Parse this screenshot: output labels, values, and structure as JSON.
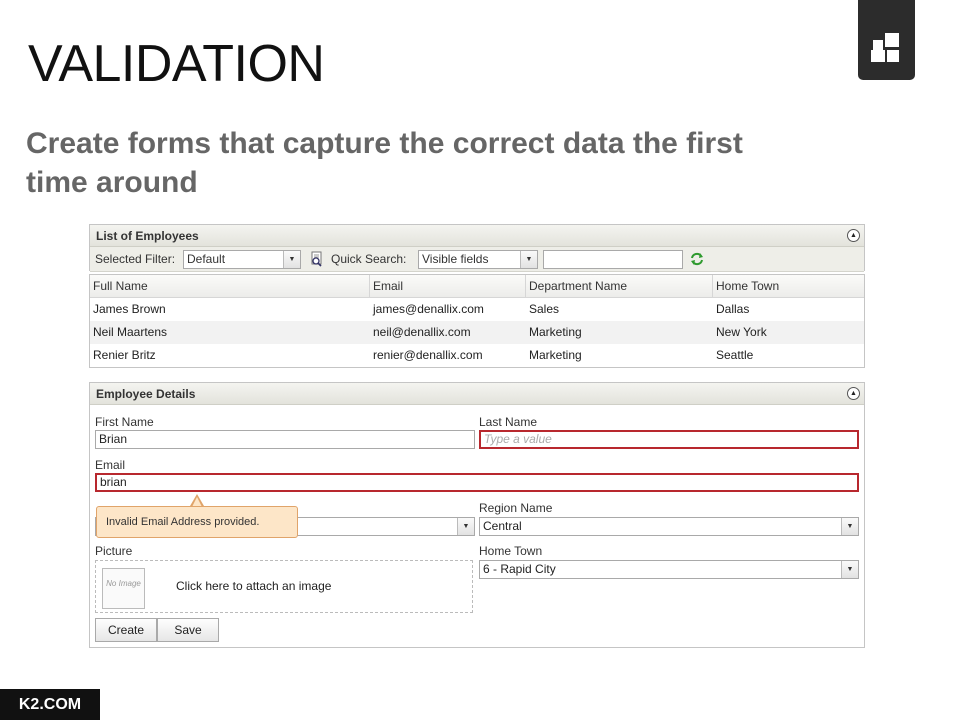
{
  "slide": {
    "title": "VALIDATION",
    "subtitle": "Create forms that capture the correct data the first time around",
    "footer": "K2.COM"
  },
  "employees_panel": {
    "title": "List of Employees",
    "selected_filter_label": "Selected Filter:",
    "selected_filter_value": "Default",
    "quick_search_label": "Quick Search:",
    "quick_search_scope": "Visible fields",
    "quick_search_value": ""
  },
  "grid": {
    "columns": [
      "Full Name",
      "Email",
      "Department Name",
      "Home Town"
    ],
    "rows": [
      [
        "James Brown",
        "james@denallix.com",
        "Sales",
        "Dallas"
      ],
      [
        "Neil Maartens",
        "neil@denallix.com",
        "Marketing",
        "New York"
      ],
      [
        "Renier Britz",
        "renier@denallix.com",
        "Marketing",
        "Seattle"
      ]
    ]
  },
  "details_panel": {
    "title": "Employee Details",
    "first_name_label": "First Name",
    "first_name_value": "Brian",
    "last_name_label": "Last Name",
    "last_name_placeholder": "Type a value",
    "email_label": "Email",
    "email_value": "brian",
    "error_message": "Invalid Email Address provided.",
    "region_label": "Region Name",
    "region_value": "Central",
    "picture_label": "Picture",
    "no_image_text": "No Image",
    "attach_text": "Click here to attach an image",
    "home_town_label": "Home Town",
    "home_town_value": "6 - Rapid City",
    "create_label": "Create",
    "save_label": "Save"
  },
  "colors": {
    "error_border": "#b8282e",
    "tooltip_bg": "#fde6c8",
    "refresh_icon": "#2e9a2e"
  },
  "icons": [
    "logo-squares-icon",
    "collapse-icon",
    "dropdown-arrow-icon",
    "search-doc-icon",
    "refresh-icon"
  ]
}
